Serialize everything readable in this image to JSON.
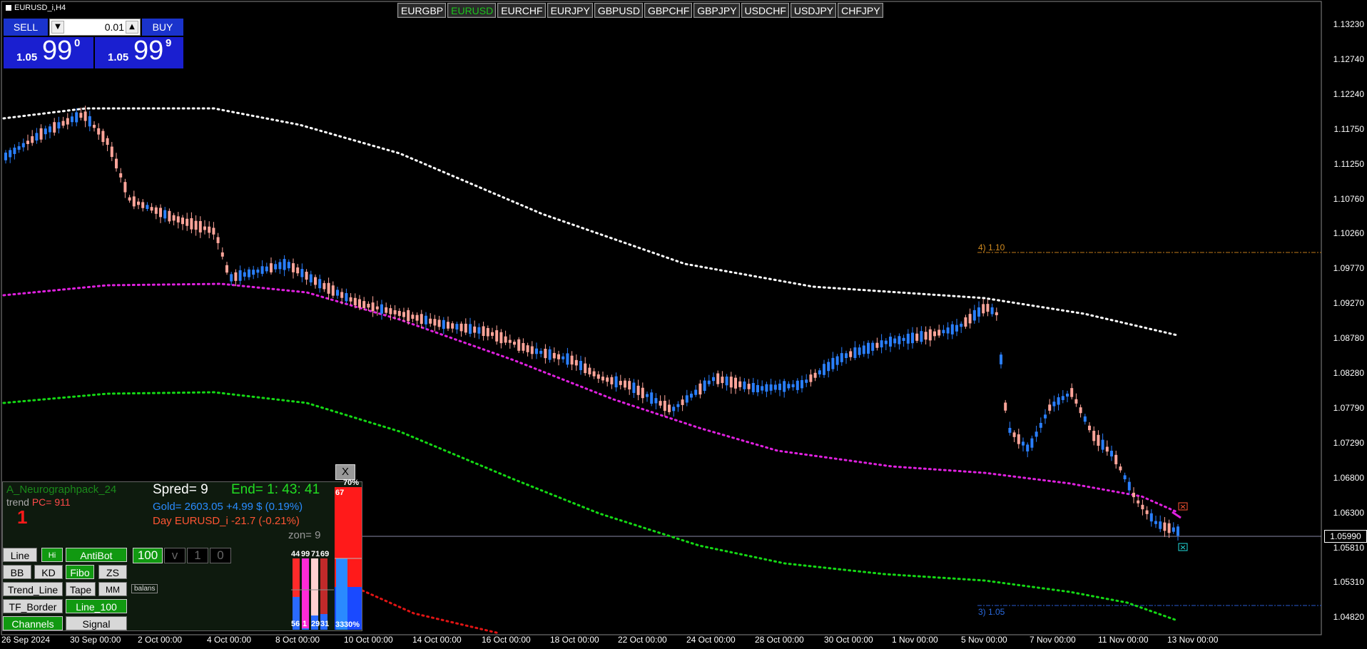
{
  "window": {
    "title": "EURUSD_i,H4"
  },
  "symbol_tabs": [
    "EURGBP",
    "EURUSD",
    "EURCHF",
    "EURJPY",
    "GBPUSD",
    "GBPCHF",
    "GBPJPY",
    "USDCHF",
    "USDJPY",
    "CHFJPY"
  ],
  "active_symbol": "EURUSD",
  "trade_panel": {
    "sell_label": "SELL",
    "buy_label": "BUY",
    "lot": "0.01",
    "sell_price_small": "1.05",
    "sell_price_big": "99",
    "sell_price_sup": "0",
    "buy_price_small": "1.05",
    "buy_price_big": "99",
    "buy_price_sup": "9"
  },
  "price_axis": [
    "1.13230",
    "1.12740",
    "1.12240",
    "1.11750",
    "1.11250",
    "1.10760",
    "1.10260",
    "1.09770",
    "1.09270",
    "1.08780",
    "1.08280",
    "1.07790",
    "1.07290",
    "1.06800",
    "1.06300",
    "1.05810",
    "1.05310",
    "1.04820"
  ],
  "current_price": "1.05990",
  "time_axis": [
    "26 Sep 2024",
    "30 Sep 00:00",
    "2 Oct 00:00",
    "4 Oct 00:00",
    "8 Oct 00:00",
    "10 Oct 00:00",
    "14 Oct 00:00",
    "16 Oct 00:00",
    "18 Oct 00:00",
    "22 Oct 00:00",
    "24 Oct 00:00",
    "28 Oct 00:00",
    "30 Oct 00:00",
    "1 Nov 00:00",
    "5 Nov 00:00",
    "7 Nov 00:00",
    "11 Nov 00:00",
    "13 Nov 00:00"
  ],
  "levels": {
    "upper_label": "4)  1.10",
    "lower_label": "3)  1.05"
  },
  "neuro_panel": {
    "title": "A_Neurographpack_24",
    "trend_label": "trend",
    "pc_label": "PC=  911",
    "signal_digit": "1",
    "spread": "Spred= 9",
    "end": "End= 1: 43: 41",
    "gold": "Gold= 2603.05 +4.99 $ (0.19%)",
    "day": "Day EURUSD_i   -21.7 (-0.21%)",
    "zon": "zon= 9",
    "close": "X",
    "buttons": {
      "line": "Line",
      "hi": "Hi",
      "antibot": "AntiBot",
      "bb": "BB",
      "kd": "KD",
      "fibo": "Fibo",
      "zs": "ZS",
      "trend_line": "Trend_Line",
      "tape": "Tape",
      "mm": "MM",
      "tf_border": "TF_Border",
      "line_100": "Line_100",
      "channels": "Channels",
      "signal": "Signal"
    },
    "grid": [
      "100",
      "v",
      "1",
      "0"
    ],
    "balans": "balans",
    "bar_top": [
      "44",
      "99",
      "71",
      "69"
    ],
    "bar_bottom": [
      "56",
      "1",
      "29",
      "31"
    ],
    "big_top_pct": "70%",
    "big_top_val": "67",
    "big_bottom_val": "33",
    "big_bottom_pct": "30%"
  },
  "colors": {
    "bull": "#2a7fff",
    "bear": "#ffa59a",
    "ma_white": "#ffffff",
    "ma_magenta": "#e020e0",
    "ma_green": "#14d814",
    "ma_red": "#e01414"
  }
}
